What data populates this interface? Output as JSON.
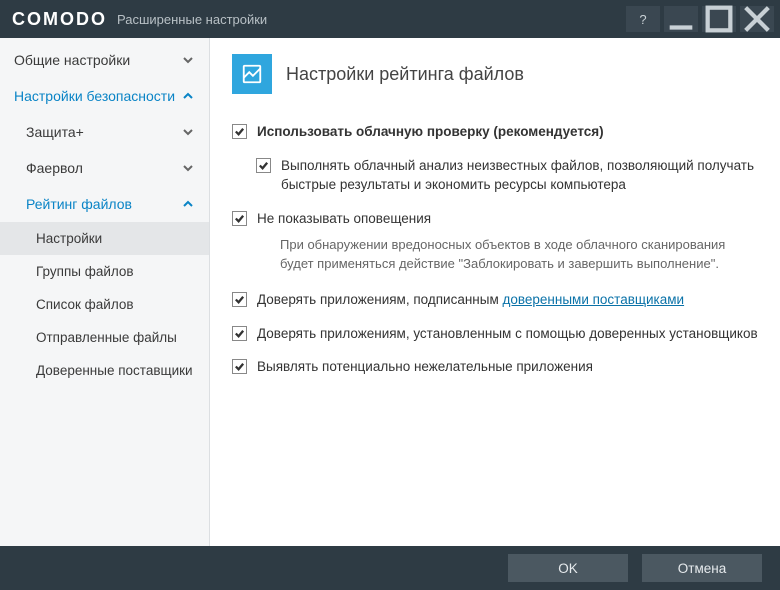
{
  "window": {
    "brand": "COMODO",
    "subtitle": "Расширенные настройки"
  },
  "sidebar": {
    "general": "Общие настройки",
    "security": "Настройки безопасности",
    "defense": "Защита+",
    "firewall": "Фаервол",
    "file_rating": "Рейтинг файлов",
    "leaves": {
      "settings": "Настройки",
      "file_groups": "Группы файлов",
      "file_list": "Список файлов",
      "submitted": "Отправленные файлы",
      "trusted_vendors": "Доверенные поставщики"
    }
  },
  "page": {
    "title": "Настройки рейтинга файлов"
  },
  "options": {
    "cloud_lookup": "Использовать облачную проверку (рекомендуется)",
    "cloud_analyze": "Выполнять облачный анализ неизвестных файлов, позволяющий получать быстрые результаты и экономить ресурсы компьютера",
    "no_alerts": "Не показывать оповещения",
    "no_alerts_desc": "При обнаружении вредоносных объектов в ходе облачного сканирования будет применяться действие \"Заблокировать и завершить выполнение\".",
    "trust_signed_prefix": "Доверять приложениям, подписанным ",
    "trust_signed_link": "доверенными поставщиками",
    "trust_installers": "Доверять приложениям, установленным с помощью доверенных установщиков",
    "detect_pua": "Выявлять потенциально нежелательные приложения"
  },
  "footer": {
    "ok": "OK",
    "cancel": "Отмена"
  }
}
